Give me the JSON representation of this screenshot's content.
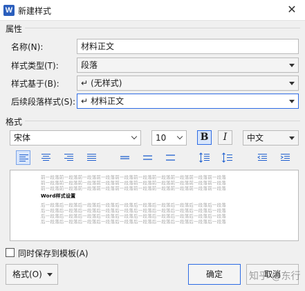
{
  "window": {
    "app_icon_letter": "W",
    "title": "新建样式",
    "close_glyph": "✕"
  },
  "sections": {
    "properties": "属性",
    "format": "格式"
  },
  "properties": {
    "name_label": "名称(N):",
    "name_value": "材料正文",
    "type_label": "样式类型(T):",
    "type_value": "段落",
    "based_on_label": "样式基于(B):",
    "based_on_value": "(无样式)",
    "next_label": "后续段落样式(S):",
    "next_value": "材料正文",
    "return_glyph": "↵"
  },
  "format": {
    "font_name": "宋体",
    "font_size": "10",
    "bold_glyph": "B",
    "italic_glyph": "I",
    "language": "中文"
  },
  "toolbar": {
    "active_alignment": "align-left",
    "items": [
      "align-left",
      "align-center",
      "align-right",
      "justify",
      "line-spacing-single",
      "line-spacing-1-5",
      "line-spacing-double",
      "paragraph-space-decrease",
      "paragraph-space-increase",
      "indent-decrease",
      "indent-increase"
    ]
  },
  "preview": {
    "prev_line": "前一段落前一段落前一段落前一段落前一段落前一段落前一段落前一段落前一段落前一段落",
    "sample_text": "Word样式设置",
    "next_line": "后一段落后一段落后一段落后一段落后一段落后一段落后一段落后一段落后一段落后一段落"
  },
  "footer": {
    "save_to_template": "同时保存到模板(A)",
    "save_to_template_checked": false,
    "format_button": "格式(O)",
    "ok_button": "确定",
    "cancel_button": "取消"
  },
  "watermark": "知乎 @东行",
  "colors": {
    "accent": "#2d6be4",
    "brand": "#2b5fbd",
    "active_fill": "#d9e6fb"
  }
}
